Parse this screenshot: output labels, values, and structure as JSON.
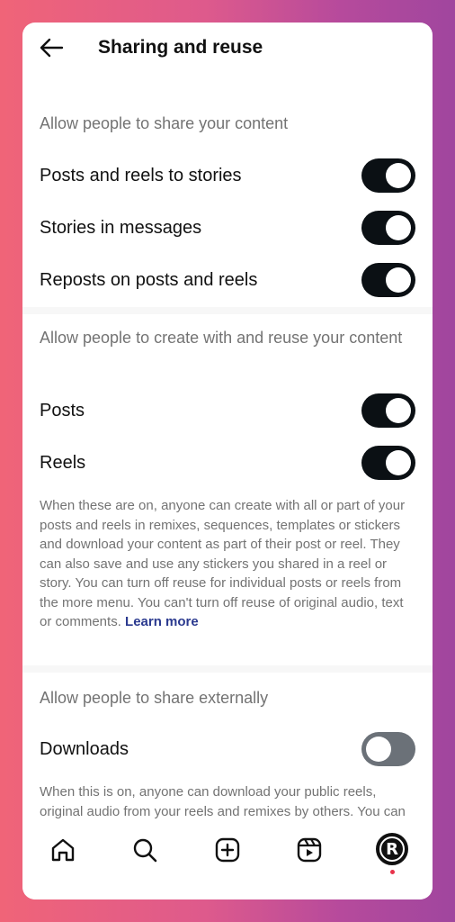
{
  "header": {
    "title": "Sharing and reuse"
  },
  "sections": [
    {
      "title": "Allow people to share your content",
      "items": [
        {
          "label": "Posts and reels to stories",
          "on": true
        },
        {
          "label": "Stories in messages",
          "on": true
        },
        {
          "label": "Reposts on posts and reels",
          "on": true
        }
      ]
    },
    {
      "title": "Allow people to create with and reuse your content",
      "items": [
        {
          "label": "Posts",
          "on": true
        },
        {
          "label": "Reels",
          "on": true
        }
      ],
      "description": "When these are on, anyone can create with all or part of your posts and reels in remixes, sequences, templates or stickers and download your content as part of their post or reel. They can also save and use any stickers you shared in a reel or story. You can turn off reuse for individual posts or reels from the more menu. You can't turn off reuse of original audio, text or comments.",
      "link": "Learn more"
    },
    {
      "title": "Allow people to share externally",
      "items": [
        {
          "label": "Downloads",
          "on": false
        }
      ],
      "description": "When this is on, anyone can download your public reels, original audio from your reels and remixes by others. You can turn off downloading for individual reels from the"
    }
  ],
  "nav": {
    "icons": [
      "home-icon",
      "search-icon",
      "create-icon",
      "reels-icon",
      "profile-avatar"
    ],
    "avatar_letter": "R"
  },
  "colors": {
    "toggle_on": "#0b1014",
    "toggle_off": "#6b7178",
    "link": "#2b3a8f",
    "notification_dot": "#e8324a"
  }
}
